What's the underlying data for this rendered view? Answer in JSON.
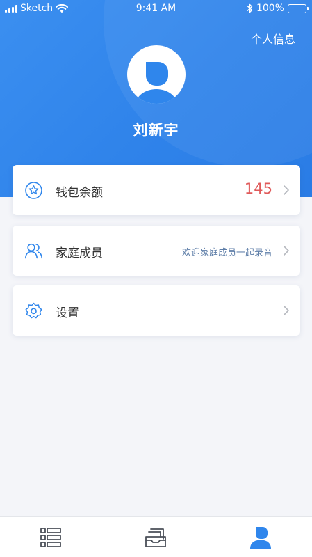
{
  "status_bar": {
    "carrier": "Sketch",
    "time": "9:41 AM",
    "battery": "100%"
  },
  "header": {
    "profile_link": "个人信息",
    "user_name": "刘新宇"
  },
  "menu": {
    "wallet": {
      "label": "钱包余额",
      "value": "145",
      "icon": "coin-icon"
    },
    "family": {
      "label": "家庭成员",
      "hint": "欢迎家庭成员一起录音",
      "icon": "users-icon"
    },
    "settings": {
      "label": "设置",
      "icon": "gear-icon"
    }
  },
  "tabbar": {
    "tabs": [
      {
        "icon": "list-icon",
        "active": false
      },
      {
        "icon": "inbox-stack-icon",
        "active": false
      },
      {
        "icon": "user-icon",
        "active": true
      }
    ]
  },
  "colors": {
    "primary": "#2f86ec",
    "accent_value": "#e05a5a",
    "hint": "#5e7ea8",
    "background": "#f4f5f9"
  }
}
